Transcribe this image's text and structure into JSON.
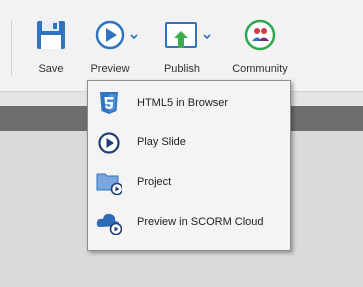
{
  "toolbar": {
    "save_label": "Save",
    "preview_label": "Preview",
    "publish_label": "Publish",
    "community_label": "Community"
  },
  "preview_menu": {
    "items": [
      {
        "label": "HTML5 in Browser",
        "icon": "html5-icon"
      },
      {
        "label": "Play Slide",
        "icon": "play-circle-icon"
      },
      {
        "label": "Project",
        "icon": "project-folder-play-icon"
      },
      {
        "label": "Preview in SCORM Cloud",
        "icon": "scorm-cloud-play-icon"
      }
    ]
  },
  "colors": {
    "accent_blue": "#2f74c0",
    "publish_green": "#3cab4b",
    "community_green": "#2da84a",
    "community_red": "#d83a4a"
  }
}
